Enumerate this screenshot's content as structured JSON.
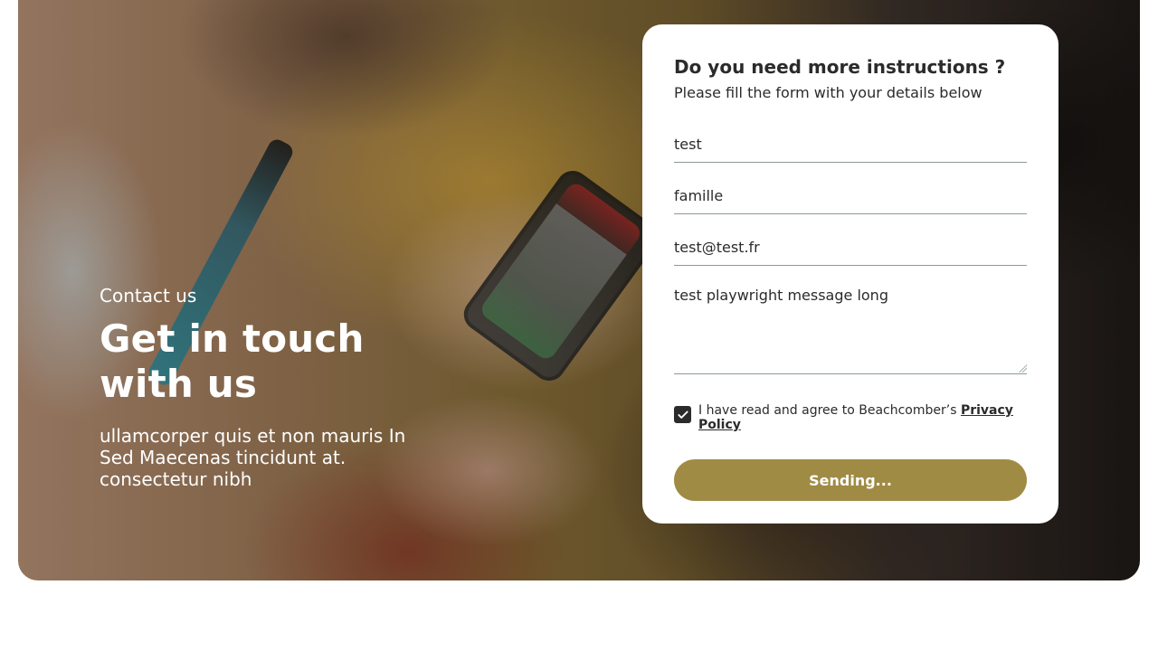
{
  "hero": {
    "kicker": "Contact us",
    "headline": "Get in touch with us",
    "body": "ullamcorper quis et non mauris In Sed Maecenas tincidunt at. consectetur nibh"
  },
  "form": {
    "title": "Do you need more instructions ?",
    "subtitle": "Please fill the form with your details below",
    "fields": {
      "first_name": {
        "value": "test"
      },
      "last_name": {
        "value": "famille"
      },
      "email": {
        "value": "test@test.fr"
      },
      "message": {
        "value": "test playwright message long"
      }
    },
    "consent": {
      "checked": true,
      "prefix": "I have read and agree to Beachcomber’s ",
      "link_label": "Privacy Policy"
    },
    "submit_label": "Sending..."
  },
  "colors": {
    "accent_button": "#a08b45",
    "card_bg": "#ffffff",
    "text_dark": "#2b2b2b",
    "line": "#8a9a9a"
  },
  "icons": {
    "checkbox_checked": "check-icon"
  }
}
